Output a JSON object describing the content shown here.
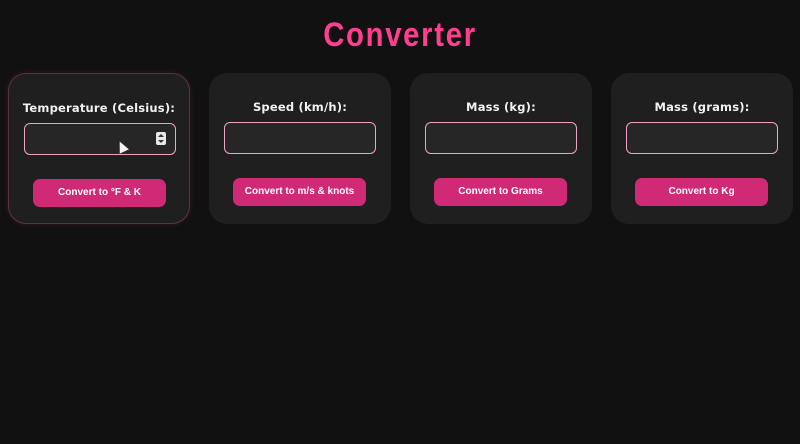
{
  "page": {
    "title": "Converter"
  },
  "cards": [
    {
      "label": "Temperature (Celsius):",
      "value": "",
      "button": "Convert to °F & K"
    },
    {
      "label": "Speed (km/h):",
      "value": "",
      "button": "Convert to m/s & knots"
    },
    {
      "label": "Mass (kg):",
      "value": "",
      "button": "Convert to Grams"
    },
    {
      "label": "Mass (grams):",
      "value": "",
      "button": "Convert to Kg"
    }
  ],
  "colors": {
    "accent": "#ff3f8e",
    "button": "#d02a77",
    "input_border": "#f0a3c4",
    "card_bg": "#1f1f1f",
    "page_bg": "#111111"
  },
  "icons": {
    "spinner": "number-spinner-icon",
    "cursor": "mouse-pointer-icon"
  }
}
